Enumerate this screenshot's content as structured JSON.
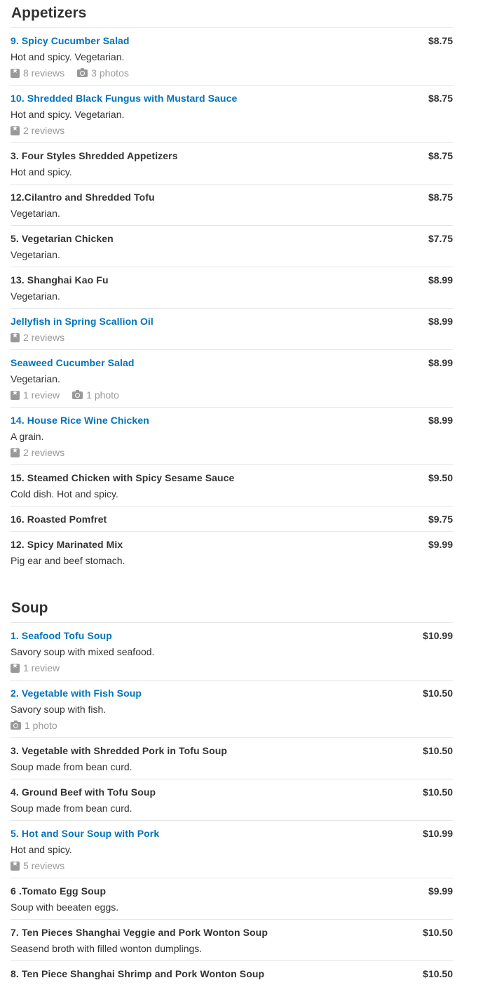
{
  "sections": [
    {
      "title": "Appetizers",
      "items": [
        {
          "name": "9. Spicy Cucumber Salad",
          "link": true,
          "desc": "Hot and spicy. Vegetarian.",
          "reviews": "8 reviews",
          "photos": "3 photos",
          "price": "$8.75"
        },
        {
          "name": "10. Shredded Black Fungus with Mustard Sauce",
          "link": true,
          "desc": "Hot and spicy. Vegetarian.",
          "reviews": "2 reviews",
          "photos": "",
          "price": "$8.75"
        },
        {
          "name": "3. Four Styles Shredded Appetizers",
          "link": false,
          "desc": "Hot and spicy.",
          "reviews": "",
          "photos": "",
          "price": "$8.75"
        },
        {
          "name": "12.Cilantro and Shredded Tofu",
          "link": false,
          "desc": "Vegetarian.",
          "reviews": "",
          "photos": "",
          "price": "$8.75"
        },
        {
          "name": "5. Vegetarian Chicken",
          "link": false,
          "desc": "Vegetarian.",
          "reviews": "",
          "photos": "",
          "price": "$7.75"
        },
        {
          "name": "13. Shanghai Kao Fu",
          "link": false,
          "desc": "Vegetarian.",
          "reviews": "",
          "photos": "",
          "price": "$8.99"
        },
        {
          "name": "Jellyfish in Spring Scallion Oil",
          "link": true,
          "desc": "",
          "reviews": "2 reviews",
          "photos": "",
          "price": "$8.99"
        },
        {
          "name": "Seaweed Cucumber Salad",
          "link": true,
          "desc": "Vegetarian.",
          "reviews": "1 review",
          "photos": "1 photo",
          "price": "$8.99"
        },
        {
          "name": "14. House Rice Wine Chicken",
          "link": true,
          "desc": "A grain.",
          "reviews": "2 reviews",
          "photos": "",
          "price": "$8.99"
        },
        {
          "name": "15. Steamed Chicken with Spicy Sesame Sauce",
          "link": false,
          "desc": "Cold dish. Hot and spicy.",
          "reviews": "",
          "photos": "",
          "price": "$9.50"
        },
        {
          "name": "16. Roasted Pomfret",
          "link": false,
          "desc": "",
          "reviews": "",
          "photos": "",
          "price": "$9.75"
        },
        {
          "name": "12. Spicy Marinated Mix",
          "link": false,
          "desc": "Pig ear and beef stomach.",
          "reviews": "",
          "photos": "",
          "price": "$9.99"
        }
      ]
    },
    {
      "title": "Soup",
      "items": [
        {
          "name": "1. Seafood Tofu Soup",
          "link": true,
          "desc": "Savory soup with mixed seafood.",
          "reviews": "1 review",
          "photos": "",
          "price": "$10.99"
        },
        {
          "name": "2. Vegetable with Fish Soup",
          "link": true,
          "desc": "Savory soup with fish.",
          "reviews": "",
          "photos": "1 photo",
          "price": "$10.50"
        },
        {
          "name": "3. Vegetable with Shredded Pork in Tofu Soup",
          "link": false,
          "desc": "Soup made from bean curd.",
          "reviews": "",
          "photos": "",
          "price": "$10.50"
        },
        {
          "name": "4. Ground Beef with Tofu Soup",
          "link": false,
          "desc": "Soup made from bean curd.",
          "reviews": "",
          "photos": "",
          "price": "$10.50"
        },
        {
          "name": "5. Hot and Sour Soup with Pork",
          "link": true,
          "desc": "Hot and spicy.",
          "reviews": "5 reviews",
          "photos": "",
          "price": "$10.99"
        },
        {
          "name": "6 .Tomato Egg Soup",
          "link": false,
          "desc": "Soup with beeaten eggs.",
          "reviews": "",
          "photos": "",
          "price": "$9.99"
        },
        {
          "name": "7. Ten Pieces Shanghai Veggie and Pork Wonton Soup",
          "link": false,
          "desc": "Seasend broth with filled wonton dumplings.",
          "reviews": "",
          "photos": "",
          "price": "$10.50"
        },
        {
          "name": "8. Ten Piece Shanghai Shrimp and Pork Wonton Soup",
          "link": false,
          "desc": "",
          "reviews": "",
          "photos": "",
          "price": "$10.50"
        }
      ]
    }
  ]
}
